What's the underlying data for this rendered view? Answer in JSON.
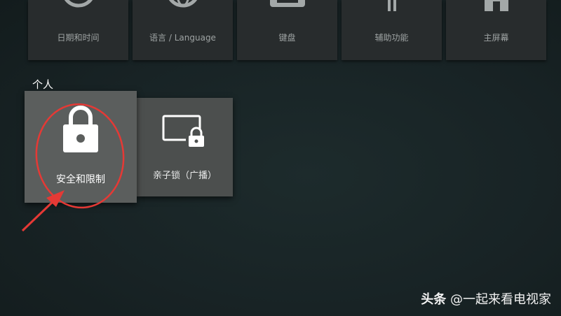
{
  "top_row": {
    "items": [
      {
        "label": "日期和时间",
        "icon": "clock-icon"
      },
      {
        "label": "语言 / Language",
        "icon": "globe-icon"
      },
      {
        "label": "键盘",
        "icon": "keyboard-icon"
      },
      {
        "label": "辅助功能",
        "icon": "accessibility-icon"
      },
      {
        "label": "主屏幕",
        "icon": "home-screen-icon"
      }
    ]
  },
  "personal": {
    "title": "个人",
    "tiles": [
      {
        "label": "安全和限制",
        "icon": "lock-icon"
      },
      {
        "label": "亲子锁（广播）",
        "icon": "screen-lock-icon"
      }
    ]
  },
  "watermark": {
    "brand": "头条",
    "handle": "@一起来看电视家"
  },
  "colors": {
    "background": "#1a2627",
    "tile_focused": "#5b5e5d",
    "annotation": "#e53935"
  }
}
